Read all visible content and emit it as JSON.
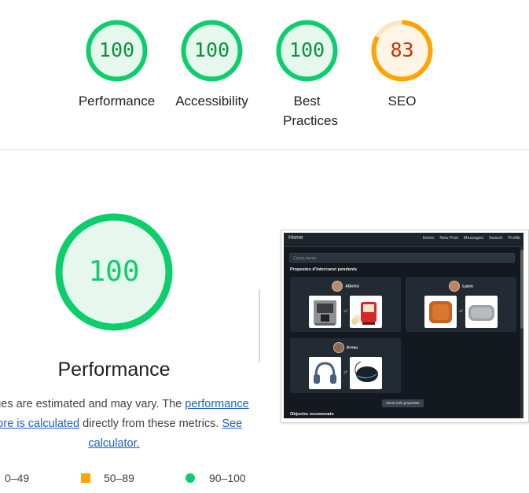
{
  "scores": [
    {
      "value": "100",
      "label": "Performance",
      "rating": "pass",
      "fraction": 1.0
    },
    {
      "value": "100",
      "label": "Accessibility",
      "rating": "pass",
      "fraction": 1.0
    },
    {
      "value": "100",
      "label": "Best Practices",
      "rating": "pass",
      "fraction": 1.0
    },
    {
      "value": "83",
      "label": "SEO",
      "rating": "average",
      "fraction": 0.83
    }
  ],
  "performance": {
    "score": "100",
    "title": "Performance",
    "desc_part1": "Values are estimated and may vary. The ",
    "desc_link1": "performance score is calculated",
    "desc_part2": " directly from these metrics. ",
    "desc_link2": "See calculator."
  },
  "legend": {
    "fail": "0–49",
    "average": "50–89",
    "pass": "90–100"
  },
  "colors": {
    "pass": "#0cce6b",
    "pass_fill": "#e6f8ed",
    "average": "#ffa400",
    "average_fill": "#fff5e6",
    "fail": "#ff4e42"
  },
  "screenshot": {
    "nav_home": "Home",
    "nav_links": [
      "Home",
      "New Post",
      "Messages",
      "Search",
      "Profile"
    ],
    "search_placeholder": "Cerca items",
    "section_pending": "Propostes d'intercanvi pendents",
    "cards": [
      {
        "user": "Alberto",
        "items": [
          "coffee-machine",
          "popcorn-machine"
        ]
      },
      {
        "user": "Laura",
        "items": [
          "orange-cushion",
          "grey-pillow"
        ]
      },
      {
        "user": "Arnau",
        "items": [
          "headphones",
          "gaming-mouse"
        ]
      }
    ],
    "more_button": "Veure més propostes",
    "section_recommended": "Objectes recomenats"
  }
}
